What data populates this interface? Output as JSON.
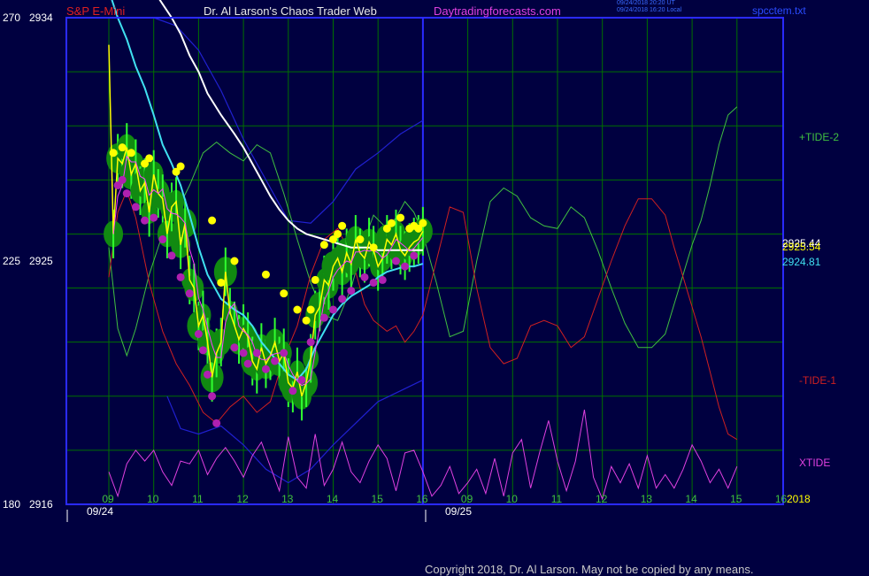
{
  "header": {
    "symbol": "S&P E-Mini",
    "site_title": "Dr. Al Larson's Chaos Trader Web",
    "site_url": "Daytradingforecasts.com",
    "timestamp_line1": "09/24/2018 20:20 UT",
    "timestamp_line2": "09/24/2018 16:20 Local",
    "filename": "spcctem.txt"
  },
  "footer": {
    "copyright": "Copyright 2018, Dr. Al Larson. May not be copied by any means."
  },
  "colors": {
    "background": "#000040",
    "plot_border": "#2a2aff",
    "grid": "#007000",
    "price": "#ffff00",
    "candle_body": "#00c000",
    "marker_high": "#ffff00",
    "marker_low": "#b020b0",
    "ma_cyan": "#40e0f0",
    "ma_white": "#ffffff",
    "band_blue": "#2020d0",
    "tide_plus": "#40c040",
    "tide_minus": "#d02020",
    "xtide": "#e040e0"
  },
  "chart_data": {
    "type": "line",
    "title": "S&P E-Mini",
    "ylim": [
      2916,
      2934
    ],
    "y_ticks": [
      {
        "left": "270",
        "value": 2934,
        "label": "2934"
      },
      {
        "left": "225",
        "value": 2925,
        "label": "2925"
      },
      {
        "left": "180",
        "value": 2916,
        "label": "2916"
      }
    ],
    "x_ticks": [
      "09",
      "10",
      "11",
      "12",
      "13",
      "14",
      "15",
      "16",
      "09",
      "10",
      "11",
      "12",
      "13",
      "14",
      "15",
      "16"
    ],
    "dates": [
      "09/24",
      "09/25"
    ],
    "year_label": "2018",
    "right_values": [
      {
        "label": "2925.44",
        "color": "#ffffff"
      },
      {
        "label": "2925.54",
        "color": "#ffff00"
      },
      {
        "label": "2924.81",
        "color": "#40e0f0"
      }
    ],
    "series": [
      {
        "name": "+TIDE-2",
        "color": "#40c040"
      },
      {
        "name": "-TIDE-1",
        "color": "#d02020"
      },
      {
        "name": "XTIDE",
        "color": "#e040e0"
      }
    ],
    "price": {
      "x": [
        9.0,
        9.1,
        9.2,
        9.3,
        9.4,
        9.5,
        9.6,
        9.7,
        9.8,
        9.9,
        10.0,
        10.1,
        10.2,
        10.3,
        10.4,
        10.5,
        10.6,
        10.7,
        10.8,
        10.9,
        11.0,
        11.1,
        11.2,
        11.3,
        11.4,
        11.5,
        11.6,
        11.7,
        11.8,
        11.9,
        12.0,
        12.1,
        12.2,
        12.3,
        12.4,
        12.5,
        12.6,
        12.7,
        12.8,
        12.9,
        13.0,
        13.1,
        13.2,
        13.3,
        13.4,
        13.5,
        13.6,
        13.7,
        13.8,
        13.9,
        14.0,
        14.1,
        14.2,
        14.3,
        14.4,
        14.5,
        14.6,
        14.7,
        14.8,
        14.9,
        15.0,
        15.1,
        15.2,
        15.3,
        15.4,
        15.5,
        15.6,
        15.7,
        15.8,
        15.9,
        16.0
      ],
      "y": [
        2933.0,
        2926.0,
        2928.8,
        2928.6,
        2929.2,
        2928.2,
        2928.6,
        2927.6,
        2927.9,
        2926.8,
        2928.2,
        2927.5,
        2927.3,
        2926.0,
        2927.0,
        2927.2,
        2925.6,
        2926.4,
        2924.3,
        2924.0,
        2922.6,
        2923.0,
        2922.0,
        2920.7,
        2921.6,
        2922.0,
        2924.6,
        2923.1,
        2922.6,
        2922.1,
        2922.5,
        2922.2,
        2921.3,
        2921.0,
        2921.8,
        2921.2,
        2921.5,
        2922.0,
        2921.3,
        2921.6,
        2920.5,
        2920.3,
        2920.9,
        2920.0,
        2920.5,
        2921.4,
        2923.0,
        2923.3,
        2924.3,
        2924.1,
        2924.8,
        2925.1,
        2924.6,
        2925.3,
        2924.9,
        2925.8,
        2925.3,
        2925.1,
        2925.7,
        2925.4,
        2924.8,
        2925.1,
        2925.8,
        2925.6,
        2926.0,
        2925.4,
        2925.2,
        2925.5,
        2925.7,
        2925.8,
        2926.1
      ]
    },
    "ma_cyan": {
      "x": [
        9.0,
        9.2,
        9.4,
        9.6,
        9.8,
        10.0,
        10.2,
        10.4,
        10.6,
        10.8,
        11.0,
        11.2,
        11.5,
        11.8,
        12.0,
        12.2,
        12.4,
        12.6,
        12.8,
        13.0,
        13.2,
        13.4,
        13.6,
        13.8,
        14.0,
        14.2,
        14.4,
        14.6,
        14.8,
        15.0,
        15.2,
        15.4,
        15.6,
        15.8,
        16.0
      ],
      "y": [
        2935,
        2934,
        2933.2,
        2932.2,
        2931.4,
        2930.4,
        2929.3,
        2928.6,
        2927.8,
        2926.7,
        2925.5,
        2924.5,
        2923.6,
        2923.2,
        2923.0,
        2922.6,
        2922.0,
        2921.6,
        2921.2,
        2920.8,
        2920.6,
        2921.0,
        2921.8,
        2922.4,
        2923.0,
        2923.4,
        2923.7,
        2923.9,
        2924.1,
        2924.4,
        2924.6,
        2924.7,
        2924.8,
        2924.8,
        2924.9
      ]
    },
    "ma_white": {
      "x": [
        10.0,
        10.2,
        10.4,
        10.6,
        10.8,
        11.0,
        11.2,
        11.5,
        11.8,
        12.0,
        12.2,
        12.4,
        12.6,
        12.8,
        13.0,
        13.2,
        13.4,
        13.6,
        13.8,
        14.0,
        14.2,
        14.4,
        14.6,
        14.8,
        15.0,
        15.2,
        15.4,
        15.6,
        15.8,
        16.0
      ],
      "y": [
        2935,
        2934.5,
        2934.0,
        2933.4,
        2932.6,
        2932.0,
        2931.2,
        2930.4,
        2929.7,
        2929.2,
        2928.6,
        2928.0,
        2927.4,
        2926.9,
        2926.5,
        2926.2,
        2926.0,
        2925.9,
        2925.8,
        2925.7,
        2925.6,
        2925.5,
        2925.5,
        2925.5,
        2925.4,
        2925.4,
        2925.4,
        2925.4,
        2925.4,
        2925.4
      ]
    },
    "band_upper": {
      "x": [
        10.0,
        10.5,
        11.0,
        11.5,
        12.0,
        12.5,
        13.0,
        13.5,
        14.0,
        14.5,
        15.0,
        15.5,
        16.0
      ],
      "y": [
        2934,
        2933.7,
        2932.8,
        2931.3,
        2929.5,
        2928.0,
        2926.5,
        2926.4,
        2927.2,
        2928.4,
        2929.0,
        2929.7,
        2930.2
      ]
    },
    "band_lower": {
      "x": [
        10.3,
        10.6,
        11.0,
        11.5,
        12.0,
        12.5,
        13.0,
        13.5,
        14.0,
        14.5,
        15.0,
        15.5,
        16.0
      ],
      "y": [
        2920.0,
        2918.8,
        2918.6,
        2918.9,
        2918.2,
        2917.3,
        2916.8,
        2917.3,
        2918.2,
        2919.0,
        2919.8,
        2920.2,
        2920.6
      ]
    },
    "tide_plus": {
      "x": [
        9.0,
        9.2,
        9.4,
        9.6,
        9.9,
        10.2,
        10.5,
        10.8,
        11.1,
        11.4,
        11.7,
        12.0,
        12.3,
        12.6,
        12.9,
        13.2,
        13.5,
        13.8,
        14.1,
        14.4,
        14.7,
        14.9,
        15.2,
        15.4,
        15.6,
        15.8,
        16.0,
        16.3,
        16.6,
        16.9,
        17.2,
        17.5,
        17.8,
        18.1,
        18.4,
        18.7,
        19.0,
        19.3,
        19.6,
        19.9,
        20.2,
        20.5,
        20.8,
        21.1,
        21.4,
        21.6,
        21.8,
        22.0,
        22.2,
        22.4,
        22.6,
        22.8,
        23.0
      ],
      "y": [
        2925.5,
        2922.5,
        2921.5,
        2922.5,
        2924.5,
        2926.0,
        2926.8,
        2927.8,
        2929.0,
        2929.4,
        2929.0,
        2928.7,
        2929.3,
        2929.0,
        2927.5,
        2925.8,
        2924.2,
        2923.0,
        2922.8,
        2924.0,
        2925.8,
        2926.7,
        2926.2,
        2926.6,
        2927.2,
        2926.8,
        2926.0,
        2924.2,
        2922.2,
        2922.4,
        2925.0,
        2927.2,
        2927.7,
        2927.4,
        2926.6,
        2926.3,
        2926.2,
        2927.0,
        2926.6,
        2925.4,
        2924.0,
        2922.7,
        2921.8,
        2921.8,
        2922.3,
        2923.4,
        2924.5,
        2925.6,
        2926.5,
        2927.8,
        2929.3,
        2930.4,
        2930.7
      ]
    },
    "tide_minus": {
      "x": [
        9.0,
        9.2,
        9.4,
        9.6,
        9.9,
        10.2,
        10.5,
        10.8,
        11.1,
        11.4,
        11.7,
        12.0,
        12.3,
        12.6,
        12.9,
        13.2,
        13.5,
        13.8,
        14.1,
        14.4,
        14.7,
        14.9,
        15.2,
        15.4,
        15.6,
        15.8,
        16.0,
        16.3,
        16.6,
        16.9,
        17.2,
        17.5,
        17.8,
        18.1,
        18.4,
        18.7,
        19.0,
        19.3,
        19.6,
        19.9,
        20.2,
        20.5,
        20.8,
        21.1,
        21.4,
        21.6,
        21.8,
        22.0,
        22.2,
        22.4,
        22.6,
        22.8,
        23.0
      ],
      "y": [
        2924.4,
        2926.8,
        2927.6,
        2926.6,
        2924.2,
        2922.4,
        2921.2,
        2920.4,
        2919.4,
        2919.0,
        2919.6,
        2920.0,
        2919.4,
        2919.8,
        2921.4,
        2922.6,
        2924.5,
        2925.8,
        2926.2,
        2925.2,
        2923.4,
        2922.8,
        2922.4,
        2922.6,
        2922.0,
        2922.4,
        2923.0,
        2925.0,
        2927.0,
        2926.8,
        2924.0,
        2921.8,
        2921.2,
        2921.4,
        2922.6,
        2922.8,
        2922.6,
        2921.8,
        2922.2,
        2923.6,
        2925.0,
        2926.3,
        2927.3,
        2927.3,
        2926.7,
        2925.5,
        2924.4,
        2923.3,
        2922.2,
        2920.9,
        2919.6,
        2918.6,
        2918.4
      ]
    },
    "xtide": {
      "x": [
        9.0,
        9.2,
        9.4,
        9.6,
        9.8,
        10.0,
        10.2,
        10.4,
        10.6,
        10.8,
        11.0,
        11.2,
        11.4,
        11.6,
        11.8,
        12.0,
        12.2,
        12.4,
        12.6,
        12.8,
        13.0,
        13.2,
        13.4,
        13.6,
        13.8,
        14.0,
        14.2,
        14.4,
        14.6,
        14.8,
        15.0,
        15.2,
        15.4,
        15.6,
        15.8,
        16.0,
        16.2,
        16.4,
        16.6,
        16.8,
        17.0,
        17.2,
        17.4,
        17.6,
        17.8,
        18.0,
        18.2,
        18.4,
        18.6,
        18.8,
        19.0,
        19.2,
        19.4,
        19.6,
        19.8,
        20.0,
        20.2,
        20.4,
        20.6,
        20.8,
        21.0,
        21.2,
        21.4,
        21.6,
        21.8,
        22.0,
        22.2,
        22.4,
        22.6,
        22.8,
        23.0
      ],
      "y": [
        2917.2,
        2916.3,
        2917.5,
        2918.0,
        2917.6,
        2918.0,
        2917.2,
        2916.7,
        2917.6,
        2917.5,
        2918.0,
        2917.1,
        2917.7,
        2918.1,
        2917.6,
        2917.0,
        2917.8,
        2918.3,
        2917.4,
        2916.5,
        2918.5,
        2917.0,
        2916.6,
        2918.6,
        2916.7,
        2917.3,
        2918.3,
        2917.2,
        2916.8,
        2917.6,
        2918.2,
        2917.7,
        2916.5,
        2917.9,
        2918.0,
        2917.2,
        2916.3,
        2916.7,
        2917.4,
        2916.4,
        2916.8,
        2917.3,
        2916.4,
        2917.7,
        2916.3,
        2917.9,
        2918.4,
        2916.6,
        2917.9,
        2919.1,
        2917.6,
        2916.5,
        2917.6,
        2919.5,
        2917.0,
        2916.2,
        2917.4,
        2916.8,
        2917.5,
        2916.6,
        2917.8,
        2916.6,
        2917.1,
        2916.6,
        2917.3,
        2918.2,
        2917.6,
        2916.8,
        2917.3,
        2916.6,
        2917.4
      ]
    },
    "highs_markers": {
      "x": [
        9.1,
        9.3,
        9.5,
        9.8,
        9.9,
        10.5,
        10.6,
        11.3,
        11.5,
        11.8,
        12.5,
        12.9,
        13.2,
        13.4,
        13.5,
        13.6,
        13.8,
        14.0,
        14.1,
        14.2,
        14.6,
        14.9,
        15.2,
        15.3,
        15.5,
        15.7,
        15.8,
        15.9,
        16.0
      ],
      "y": [
        2929.0,
        2929.2,
        2929.0,
        2928.6,
        2928.8,
        2928.3,
        2928.5,
        2926.5,
        2924.2,
        2925.0,
        2924.5,
        2923.8,
        2923.2,
        2922.8,
        2923.2,
        2924.3,
        2925.6,
        2925.8,
        2926.0,
        2926.3,
        2925.8,
        2925.5,
        2926.2,
        2926.4,
        2926.6,
        2926.2,
        2926.3,
        2926.2,
        2926.4
      ]
    },
    "lows_markers": {
      "x": [
        9.2,
        9.3,
        9.4,
        9.6,
        9.8,
        10.0,
        10.2,
        10.4,
        10.6,
        10.8,
        11.0,
        11.1,
        11.2,
        11.3,
        11.4,
        11.8,
        12.0,
        12.1,
        12.3,
        12.5,
        12.7,
        12.9,
        13.1,
        13.3,
        13.5,
        13.8,
        14.0,
        14.2,
        14.4,
        14.7,
        14.9,
        15.1,
        15.4,
        15.6,
        15.8
      ],
      "y": [
        2927.8,
        2928.0,
        2927.5,
        2927.0,
        2926.5,
        2926.6,
        2925.8,
        2925.2,
        2924.4,
        2923.8,
        2922.3,
        2921.7,
        2920.8,
        2920.0,
        2919.0,
        2921.8,
        2921.6,
        2921.2,
        2921.6,
        2921.0,
        2921.3,
        2921.6,
        2920.2,
        2920.6,
        2922.0,
        2922.9,
        2923.2,
        2923.6,
        2923.9,
        2924.4,
        2924.2,
        2924.3,
        2925.0,
        2924.8,
        2925.2
      ]
    }
  }
}
